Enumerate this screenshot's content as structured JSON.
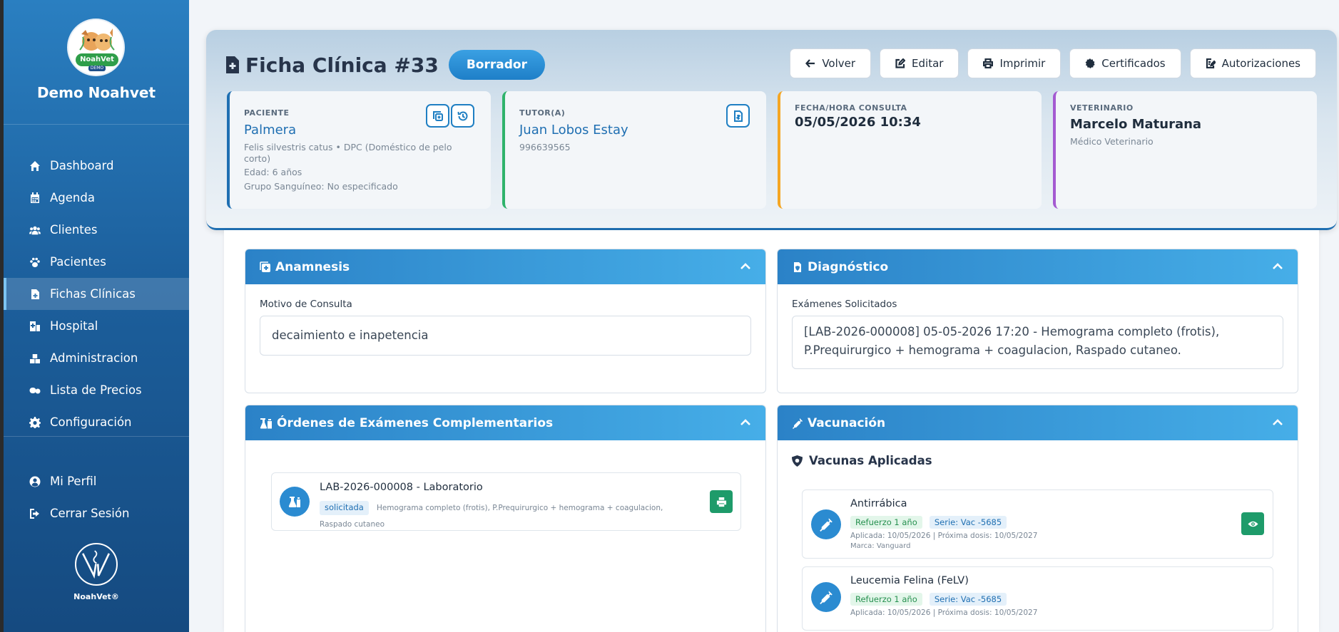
{
  "sidebar": {
    "brand_name": "Demo Noahvet",
    "logo_text": "NoahVet",
    "logo_badge": "DEMO",
    "items": [
      {
        "label": "Dashboard",
        "icon": "home-icon"
      },
      {
        "label": "Agenda",
        "icon": "calendar-icon"
      },
      {
        "label": "Clientes",
        "icon": "users-icon"
      },
      {
        "label": "Pacientes",
        "icon": "paw-icon"
      },
      {
        "label": "Fichas Clínicas",
        "icon": "file-medical-icon",
        "active": true
      },
      {
        "label": "Hospital",
        "icon": "hospital-icon"
      },
      {
        "label": "Administracion",
        "icon": "boxes-icon"
      },
      {
        "label": "Lista de Precios",
        "icon": "pills-icon"
      },
      {
        "label": "Configuración",
        "icon": "gear-icon"
      }
    ],
    "bottom_items": [
      {
        "label": "Mi Perfil",
        "icon": "user-circle-icon"
      },
      {
        "label": "Cerrar Sesión",
        "icon": "logout-icon"
      }
    ],
    "footer_name": "NoahVet®"
  },
  "header": {
    "title": "Ficha Clínica #33",
    "status": "Borrador",
    "actions": {
      "back": "Volver",
      "edit": "Editar",
      "print": "Imprimir",
      "certificates": "Certificados",
      "authorizations": "Autorizaciones"
    }
  },
  "patient": {
    "label": "PACIENTE",
    "name": "Palmera",
    "species": "Felis silvestris catus • DPC (Doméstico de pelo corto)",
    "age": "Edad: 6 años",
    "blood": "Grupo Sanguíneo: No especificado"
  },
  "tutor": {
    "label": "TUTOR(A)",
    "name": "Juan Lobos Estay",
    "phone": "996639565"
  },
  "consult": {
    "label": "FECHA/HORA CONSULTA",
    "datetime": "05/05/2026 10:34"
  },
  "vet": {
    "label": "VETERINARIO",
    "name": "Marcelo Maturana",
    "role": "Médico Veterinario"
  },
  "anamnesis": {
    "title": "Anamnesis",
    "field_label": "Motivo de Consulta",
    "value": "decaimiento e inapetencia"
  },
  "diagnostico": {
    "title": "Diagnóstico",
    "field_label": "Exámenes Solicitados",
    "value": "[LAB-2026-000008] 05-05-2026 17:20 - Hemograma completo (frotis), P.Prequirurgico + hemograma + coagulacion, Raspado cutaneo."
  },
  "ordenes": {
    "title": "Órdenes de Exámenes Complementarios",
    "order": {
      "title": "LAB-2026-000008 - Laboratorio",
      "status": "solicitada",
      "detail": "Hemograma completo (frotis), P.Prequirurgico + hemograma + coagulacion, Raspado cutaneo"
    }
  },
  "vacunacion": {
    "title": "Vacunación",
    "subtitle": "Vacunas Aplicadas",
    "vaccines": [
      {
        "name": "Antirrábica",
        "type": "Refuerzo 1 año",
        "serie": "Serie: Vac -5685",
        "dates": "Aplicada: 10/05/2026 | Próxima dosis: 10/05/2027",
        "brand": "Marca: Vanguard"
      },
      {
        "name": "Leucemia Felina (FeLV)",
        "type": "Refuerzo 1 año",
        "serie": "Serie: Vac -5685",
        "dates": "Aplicada: 10/05/2026 | Próxima dosis: 10/05/2027"
      }
    ]
  },
  "colors": {
    "sidebar": "#1c5f9c",
    "accent": "#1f6fb2",
    "status_pill": "#2b8fd6",
    "green_button": "#1e9b6a"
  }
}
